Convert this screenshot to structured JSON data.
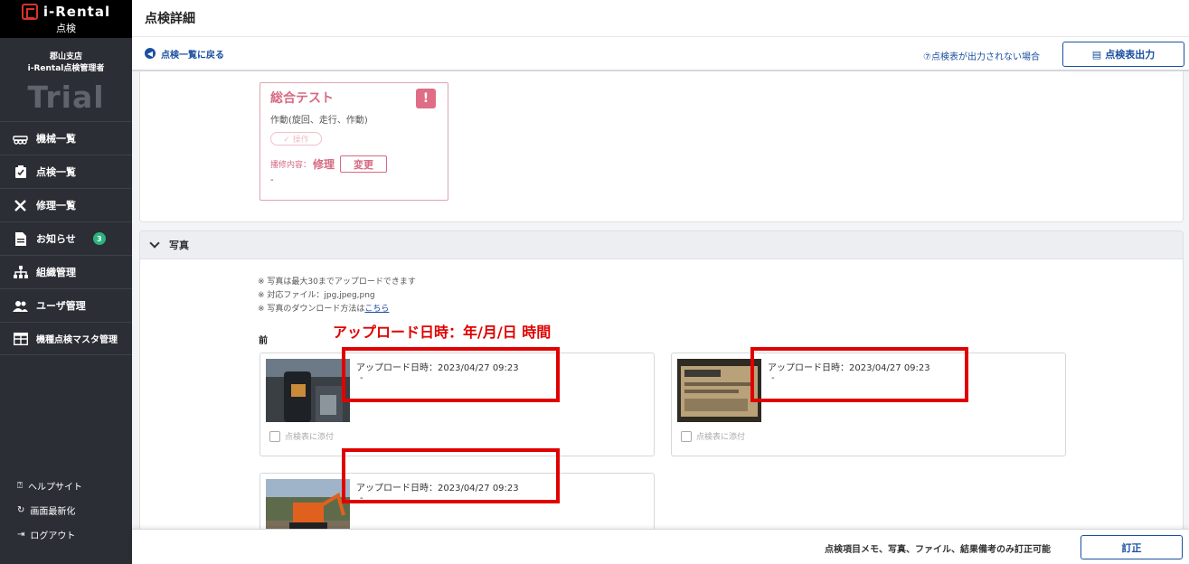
{
  "brand": {
    "name": "i-Rental",
    "subtitle": "点検"
  },
  "org": {
    "branch": "郡山支店",
    "role": "i-Rental点検管理者",
    "plan": "Trial"
  },
  "sidebar": {
    "items": [
      {
        "label": "機械一覧",
        "icon": "machine-icon"
      },
      {
        "label": "点検一覧",
        "icon": "clipboard-check-icon"
      },
      {
        "label": "修理一覧",
        "icon": "tools-icon"
      },
      {
        "label": "お知らせ",
        "icon": "document-icon",
        "badge": "3"
      },
      {
        "label": "組織管理",
        "icon": "org-chart-icon"
      },
      {
        "label": "ユーザ管理",
        "icon": "users-icon"
      },
      {
        "label": "機種点検マスタ管理",
        "icon": "table-grid-icon"
      }
    ],
    "bottom": [
      {
        "label": "ヘルプサイト",
        "icon": "help-circle-icon"
      },
      {
        "label": "画面最新化",
        "icon": "refresh-icon"
      },
      {
        "label": "ログアウト",
        "icon": "logout-icon"
      }
    ]
  },
  "header": {
    "title": "点検詳細"
  },
  "subbar": {
    "back_label": "点検一覧に戻る",
    "help_label": "⑦点検表が出力されない場合",
    "output_label": "点検表出力"
  },
  "test_item": {
    "title": "総合テスト",
    "description": "作動(旋回、走行、作動)",
    "status_pill": "✓ 操作",
    "repair_label": "播修内容：",
    "repair_value": "修理",
    "change_label": "変更",
    "note": "-"
  },
  "photos": {
    "section_title": "写真",
    "notes": [
      "※ 写真は最大30までアップロードできます",
      "※ 対応ファイル：jpg,jpeg,png",
      "※ 写真のダウンロード方法は"
    ],
    "notes_link": "こちら",
    "annotation": "アップロード日時：年/月/日  時間",
    "group_label": "前",
    "cards": [
      {
        "upload": "アップロード日時：2023/04/27 09:23",
        "memo": "-",
        "attach_label": "点検表に添付"
      },
      {
        "upload": "アップロード日時：2023/04/27 09:23",
        "memo": "-",
        "attach_label": "点検表に添付"
      },
      {
        "upload": "アップロード日時：2023/04/27 09:23",
        "memo": "-",
        "attach_label": ""
      }
    ]
  },
  "footer": {
    "note": "点検項目メモ、写真、ファイル、結果備考のみ訂正可能",
    "fix_label": "訂正"
  },
  "colors": {
    "accent": "#1a4fa0",
    "alert": "#d66a82",
    "highlight": "#e00000",
    "sidebar": "#2b2e35"
  }
}
